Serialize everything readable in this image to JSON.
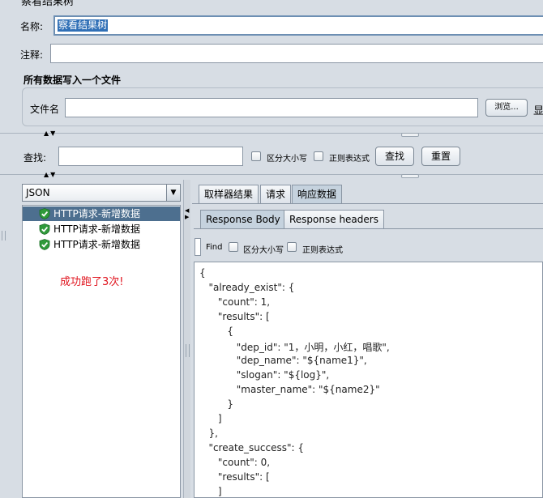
{
  "header": {
    "partial_title": "察看结果树",
    "name_label": "名称:",
    "name_value": "察看结果树",
    "comment_label": "注释:"
  },
  "file_section": {
    "title": "所有数据写入一个文件",
    "filename_label": "文件名",
    "browse_label": "浏览...",
    "display_label": "显"
  },
  "search_bar": {
    "label": "查找:",
    "case_label": "区分大小写",
    "regex_label": "正则表达式",
    "search_button": "查找",
    "reset_button": "重置"
  },
  "left_panel": {
    "renderer_select": "JSON",
    "items": [
      {
        "label": "HTTP请求-新增数据"
      },
      {
        "label": "HTTP请求-新增数据"
      },
      {
        "label": "HTTP请求-新增数据"
      }
    ],
    "annotation": "成功跑了3次!"
  },
  "result_tabs": {
    "sampler_result": "取样器结果",
    "request": "请求",
    "response_data": "响应数据"
  },
  "response_tabs": {
    "body": "Response Body",
    "headers": "Response headers"
  },
  "find_bar": {
    "label": "Find",
    "case_label": "区分大小写",
    "regex_label": "正则表达式"
  },
  "json_lines": [
    "{",
    "   \"already_exist\": {",
    "      \"count\": 1,",
    "      \"results\": [",
    "         {",
    "            \"dep_id\": \"1，小明，小红，唱歌\",",
    "            \"dep_name\": \"${name1}\",",
    "            \"slogan\": \"${log}\",",
    "            \"master_name\": \"${name2}\"",
    "         }",
    "      ]",
    "   },",
    "   \"create_success\": {",
    "      \"count\": 0,",
    "      \"results\": [",
    "      ]"
  ],
  "colors": {
    "background": "#d7dde4",
    "selection": "#4d6f8f",
    "annotation_red": "#e0141e",
    "shield_green": "#2f9a3a"
  }
}
